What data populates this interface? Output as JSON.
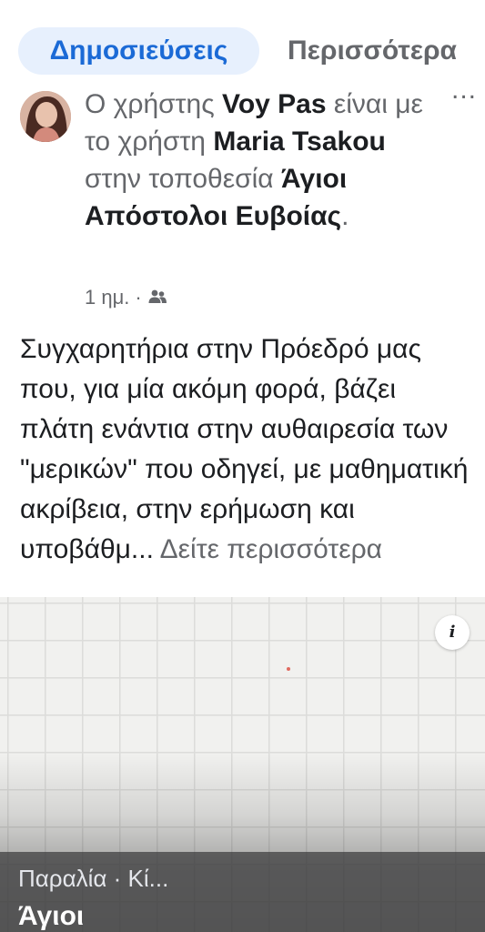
{
  "tabs": {
    "posts": "Δημοσιεύσεις",
    "more": "Περισσότερα"
  },
  "post": {
    "prefix": "Ο χρήστης",
    "author": "Voy Pas",
    "mid1": "είναι με το χρήστη",
    "tagged": "Maria Tsakou",
    "mid2": "στην τοποθεσία",
    "location": "Άγιοι Απόστολοι Ευβοίας",
    "period": ".",
    "time": "1 ημ.",
    "separator": "·",
    "more_icon": "...",
    "audience_icon": "friends-icon",
    "body": "Συγχαρητήρια στην Πρόεδρό μας που, για μία ακόμη φορά, βάζει πλάτη ενάντια στην αυθαιρεσία των \"μερικών\" που οδηγεί, με μαθηματική ακρίβεια, στην ερήμωση και υποβάθμ...",
    "see_more": "Δείτε περισσότερα"
  },
  "map": {
    "info_icon": "i",
    "place_category": "Παραλία · Κί...",
    "place_name": "Άγιοι"
  },
  "colors": {
    "accent": "#1b6ad6",
    "tab_bg": "#e7f0fd",
    "secondary_text": "#65676b"
  }
}
